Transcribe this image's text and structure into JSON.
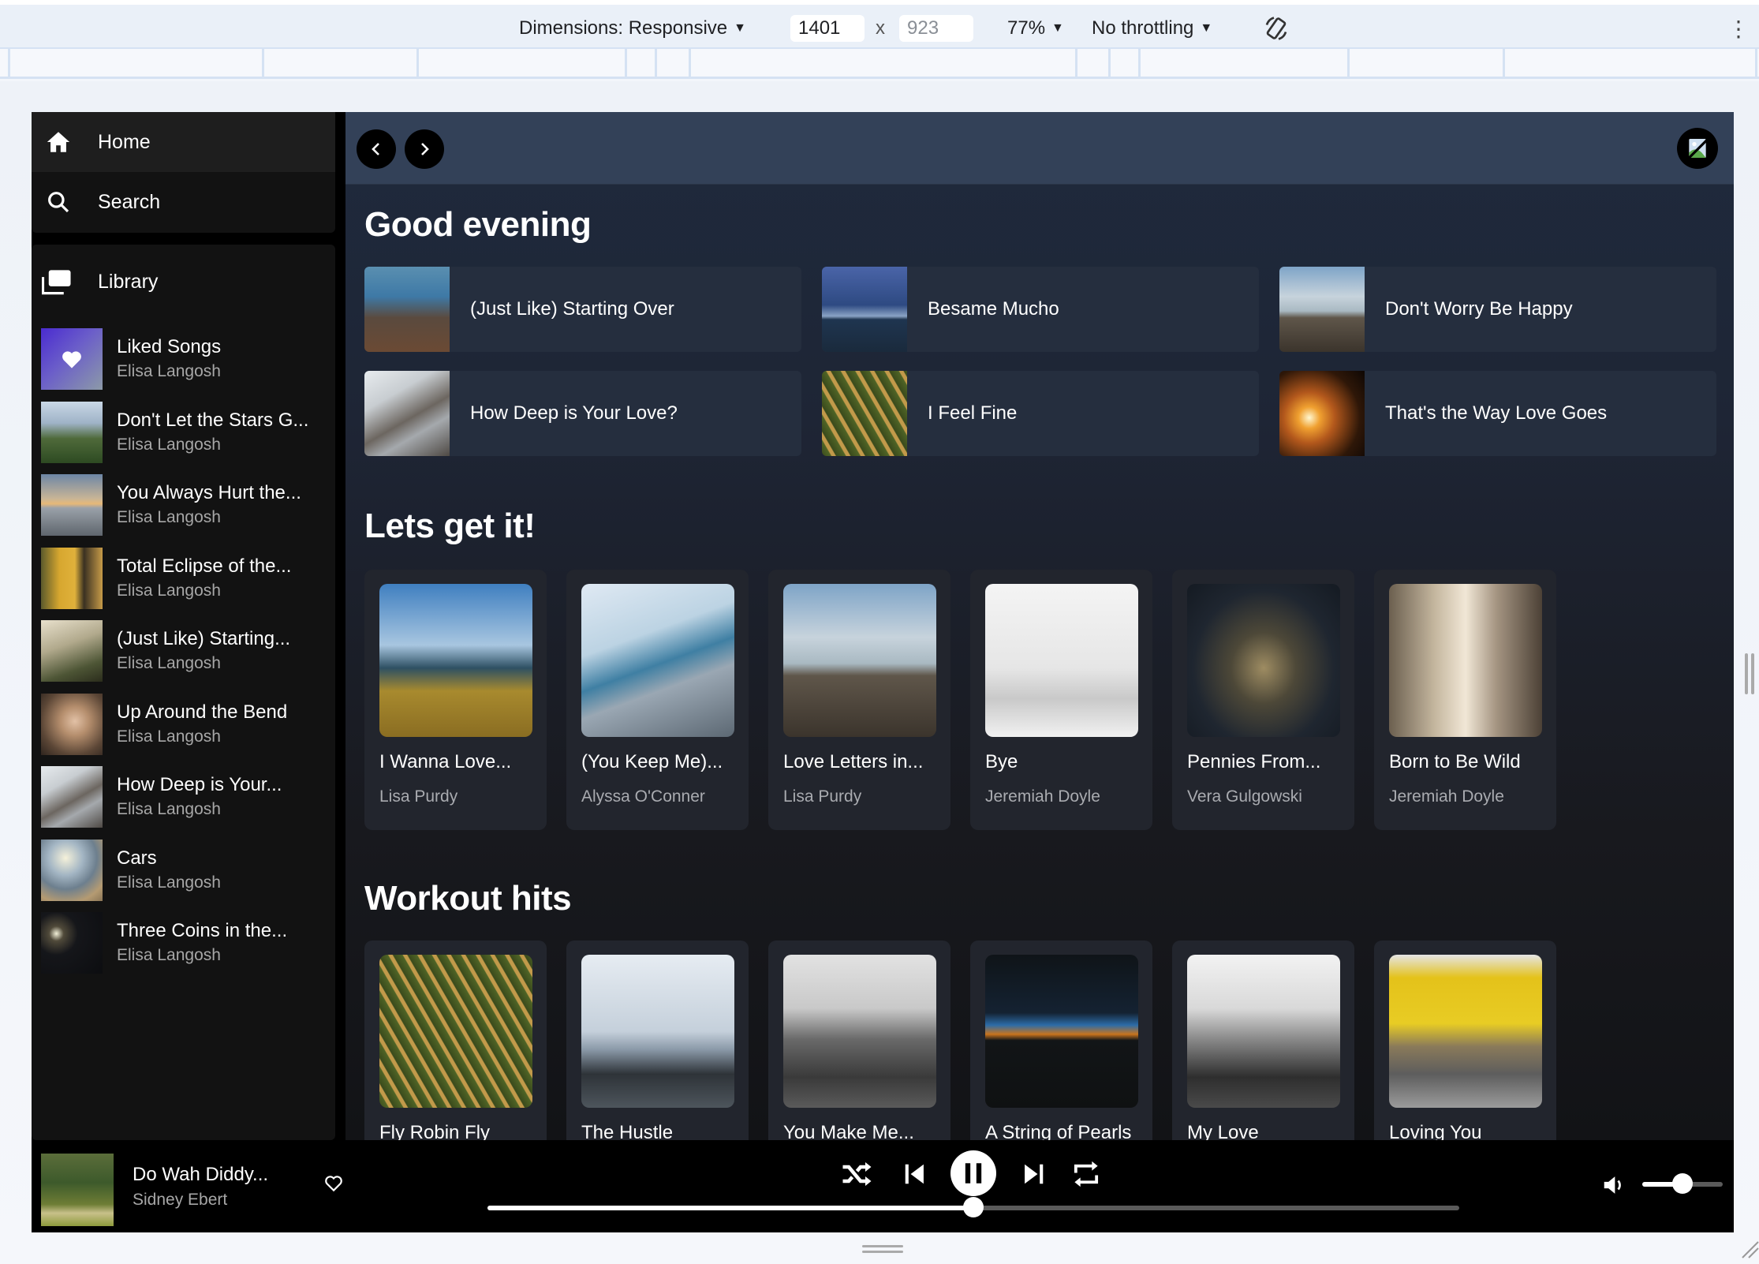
{
  "devtools": {
    "dimensions_label": "Dimensions: Responsive",
    "width_value": "1401",
    "times": "x",
    "height_value": "923",
    "zoom_label": "77%",
    "throttle_label": "No throttling"
  },
  "sidebar": {
    "nav": [
      {
        "label": "Home",
        "icon": "home-icon",
        "active": true
      },
      {
        "label": "Search",
        "icon": "search-icon",
        "active": false
      }
    ],
    "library_label": "Library",
    "library_items": [
      {
        "title": "Liked Songs",
        "subtitle": "Elisa Langosh",
        "art": "liked"
      },
      {
        "title": "Don't Let the Stars G...",
        "subtitle": "Elisa Langosh",
        "art": "castle"
      },
      {
        "title": "You Always Hurt the...",
        "subtitle": "Elisa Langosh",
        "art": "dusk-sea"
      },
      {
        "title": "Total Eclipse of the...",
        "subtitle": "Elisa Langosh",
        "art": "yellow-house"
      },
      {
        "title": "(Just Like) Starting...",
        "subtitle": "Elisa Langosh",
        "art": "fog-forest"
      },
      {
        "title": "Up Around the Bend",
        "subtitle": "Elisa Langosh",
        "art": "portrait"
      },
      {
        "title": "How Deep is Your...",
        "subtitle": "Elisa Langosh",
        "art": "desk"
      },
      {
        "title": "Cars",
        "subtitle": "Elisa Langosh",
        "art": "beach-sun"
      },
      {
        "title": "Three Coins in the...",
        "subtitle": "Elisa Langosh",
        "art": "night-lamps"
      }
    ]
  },
  "header": {
    "back_icon": "chevron-left-icon",
    "forward_icon": "chevron-right-icon",
    "avatar_icon": "broken-image-icon"
  },
  "sections": {
    "greeting": "Good evening",
    "quick_picks": [
      {
        "title": "(Just Like) Starting Over",
        "art": "misty-field"
      },
      {
        "title": "Besame Mucho",
        "art": "ocean-night"
      },
      {
        "title": "Don't Worry Be Happy",
        "art": "pier"
      },
      {
        "title": "How Deep is Your Love?",
        "art": "desk"
      },
      {
        "title": "I Feel Fine",
        "art": "crop-rows"
      },
      {
        "title": "That's the Way Love Goes",
        "art": "sunset"
      }
    ],
    "rows": [
      {
        "title": "Lets get it!",
        "cards": [
          {
            "title": "I Wanna Love...",
            "artist": "Lisa Purdy",
            "art": "grass-sea"
          },
          {
            "title": "(You Keep Me)...",
            "artist": "Alyssa O'Conner",
            "art": "pebble-beach"
          },
          {
            "title": "Love Letters in...",
            "artist": "Lisa Purdy",
            "art": "pier"
          },
          {
            "title": "Bye",
            "artist": "Jeremiah Doyle",
            "art": "white-desk"
          },
          {
            "title": "Pennies From...",
            "artist": "Vera Gulgowski",
            "art": "dark-wall"
          },
          {
            "title": "Born to Be Wild",
            "artist": "Jeremiah Doyle",
            "art": "street"
          }
        ]
      },
      {
        "title": "Workout hits",
        "cards": [
          {
            "title": "Fly Robin Fly",
            "artist": "",
            "art": "crop-rows"
          },
          {
            "title": "The Hustle",
            "artist": "",
            "art": "rocky-sea"
          },
          {
            "title": "You Make Me...",
            "artist": "",
            "art": "mono-hill"
          },
          {
            "title": "A String of Pearls",
            "artist": "",
            "art": "horizon-night"
          },
          {
            "title": "My Love",
            "artist": "",
            "art": "mono-beach"
          },
          {
            "title": "Loving You",
            "artist": "",
            "art": "cars-yellow"
          }
        ]
      }
    ]
  },
  "player": {
    "title": "Do Wah Diddy...",
    "artist": "Sidney Ebert",
    "art": "hill-sheep",
    "is_playing": true,
    "progress": 0.5,
    "volume": 0.5,
    "controls": [
      "shuffle-icon",
      "previous-icon",
      "pause-icon",
      "next-icon",
      "repeat-icon"
    ]
  }
}
